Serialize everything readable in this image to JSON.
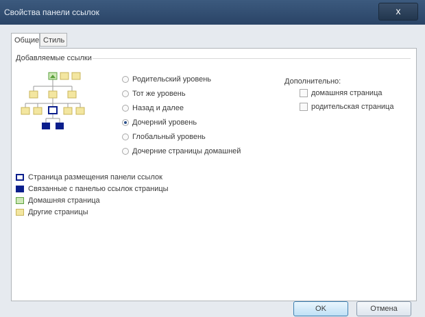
{
  "window": {
    "title": "Свойства панели ссылок",
    "close_glyph": "x"
  },
  "tabs": [
    {
      "label": "Общие",
      "active": true
    },
    {
      "label": "Стиль",
      "active": false
    }
  ],
  "section": {
    "title": "Добавляемые ссылки"
  },
  "radios": [
    {
      "label": "Родительский уровень",
      "checked": false
    },
    {
      "label": "Тот же уровень",
      "checked": false
    },
    {
      "label": "Назад и далее",
      "checked": false
    },
    {
      "label": "Дочерний уровень",
      "checked": true
    },
    {
      "label": "Глобальный уровень",
      "checked": false
    },
    {
      "label": "Дочерние страницы домашней",
      "checked": false
    }
  ],
  "extra": {
    "title": "Дополнительно:",
    "checkboxes": [
      {
        "label": "домашняя страница",
        "checked": false
      },
      {
        "label": "родительская страница",
        "checked": false
      }
    ]
  },
  "legend": [
    {
      "label": "Страница размещения панели ссылок",
      "icon": "outlined-blue-page-icon"
    },
    {
      "label": "Связанные с панелью ссылок страницы",
      "icon": "filled-blue-page-icon"
    },
    {
      "label": "Домашняя страница",
      "icon": "home-page-icon"
    },
    {
      "label": "Другие страницы",
      "icon": "yellow-page-icon"
    }
  ],
  "buttons": {
    "ok": "OK",
    "cancel": "Отмена"
  },
  "colors": {
    "titlebar": "#2f4c70",
    "navy": "#0a1e8c",
    "yellow": "#f3e6a0",
    "home_green": "#5aa03c"
  }
}
